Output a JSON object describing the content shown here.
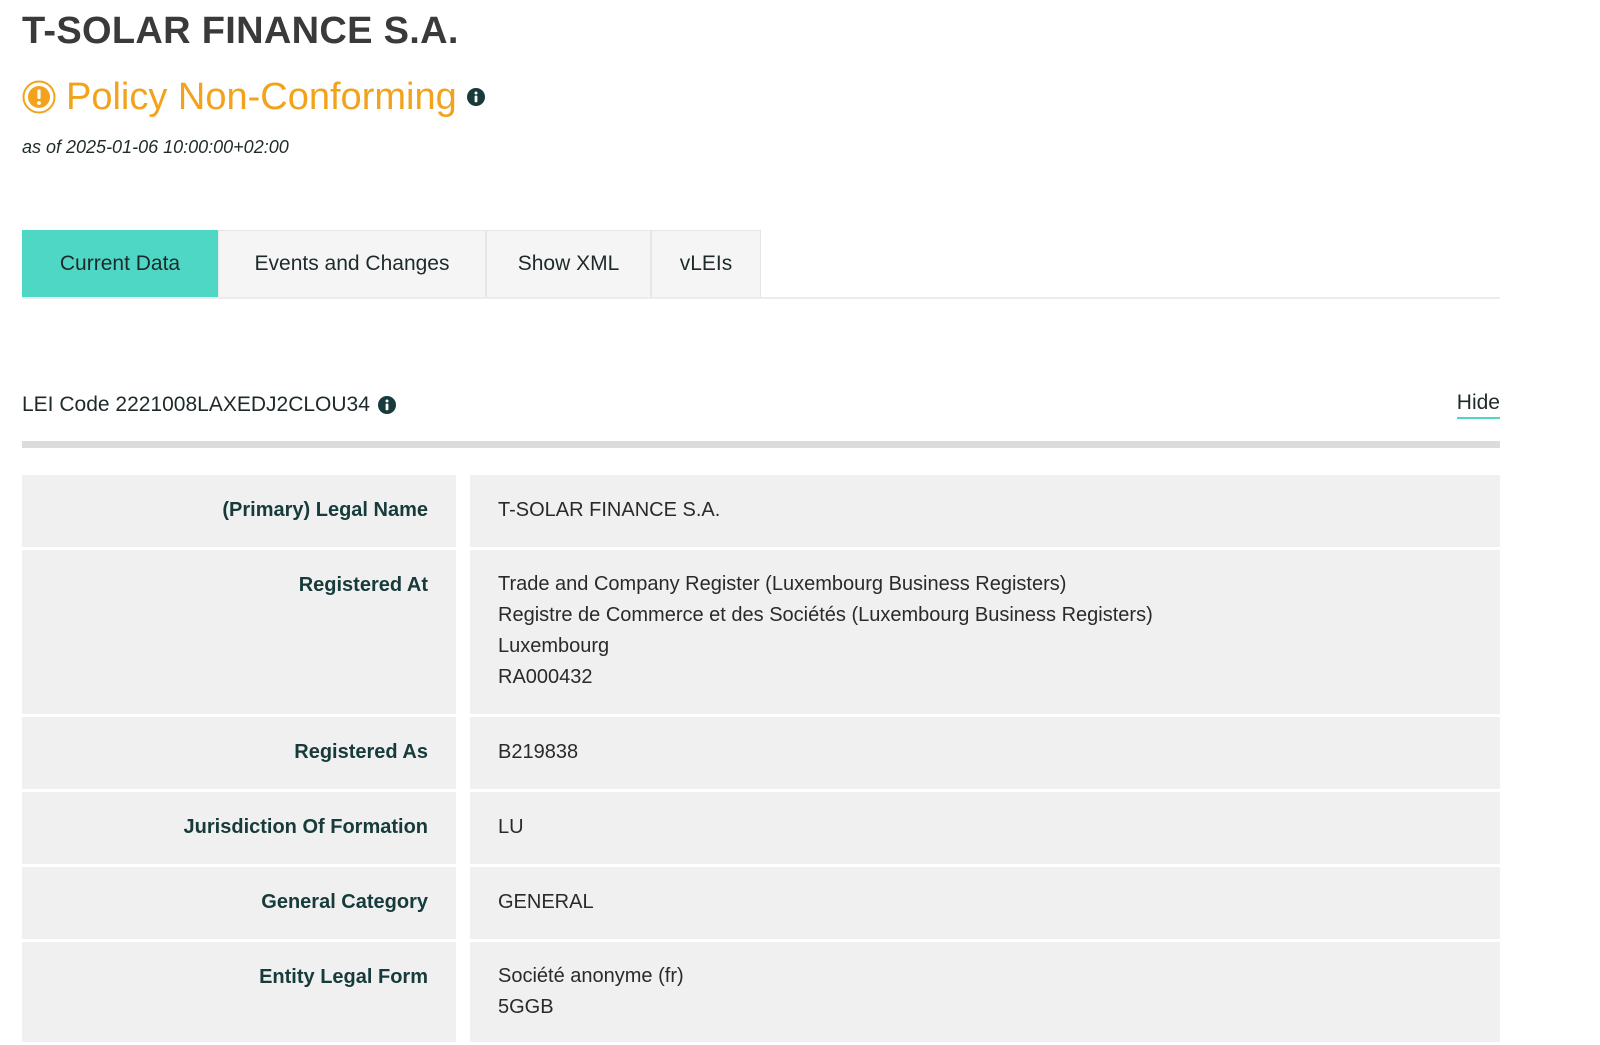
{
  "entity": {
    "title": "T-SOLAR FINANCE S.A.",
    "status": "Policy Non-Conforming",
    "as_of": "as of 2025-01-06 10:00:00+02:00"
  },
  "tabs": [
    {
      "label": "Current Data",
      "active": true
    },
    {
      "label": "Events and Changes",
      "active": false
    },
    {
      "label": "Show XML",
      "active": false
    },
    {
      "label": "vLEIs",
      "active": false
    }
  ],
  "lei": {
    "label": "LEI Code 2221008LAXEDJ2CLOU34",
    "toggle_label": "Hide"
  },
  "records": [
    {
      "label": "(Primary) Legal Name",
      "value_lines": [
        "T-SOLAR FINANCE S.A."
      ]
    },
    {
      "label": "Registered At",
      "value_lines": [
        "Trade and Company Register (Luxembourg Business Registers)",
        "Registre de Commerce et des Sociétés (Luxembourg Business Registers)",
        "Luxembourg",
        "RA000432"
      ]
    },
    {
      "label": "Registered As",
      "value_lines": [
        "B219838"
      ]
    },
    {
      "label": "Jurisdiction Of Formation",
      "value_lines": [
        "LU"
      ]
    },
    {
      "label": "General Category",
      "value_lines": [
        "GENERAL"
      ]
    },
    {
      "label": "Entity Legal Form",
      "value_lines": [
        "Société anonyme (fr)",
        "5GGB"
      ]
    }
  ],
  "colors": {
    "accent_teal": "#4fd7c5",
    "status_orange": "#f2a31b",
    "row_background": "#f0f0f0"
  },
  "icons": {
    "status": "warning-circle-icon",
    "info": "info-icon"
  }
}
